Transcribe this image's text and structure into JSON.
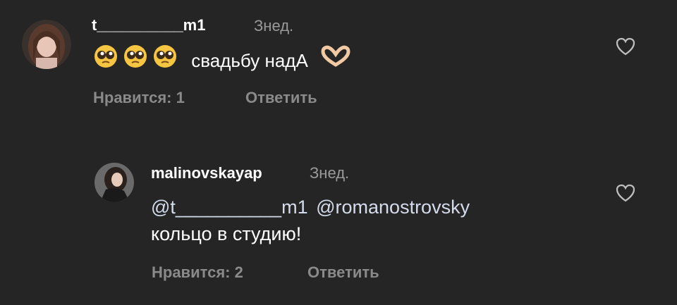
{
  "comments": [
    {
      "username": "t__________m1",
      "time": "Знед.",
      "emoji_prefix": [
        "pleading-face",
        "pleading-face",
        "pleading-face"
      ],
      "text": "свадьбу надА",
      "emoji_suffix": "heart-hands",
      "likes_label": "Нравится: 1",
      "reply_label": "Ответить"
    },
    {
      "username": "malinovskayap",
      "time": "Знед.",
      "mention_1": "@t__________m1",
      "mention_2": "@romanostrovsky",
      "text_line_2": "кольцо в студию!",
      "likes_label": "Нравится: 2",
      "reply_label": "Ответить"
    }
  ],
  "colors": {
    "background": "#252525",
    "text": "#ffffff",
    "muted": "#8a8a8a",
    "mention": "#d4dcec"
  }
}
